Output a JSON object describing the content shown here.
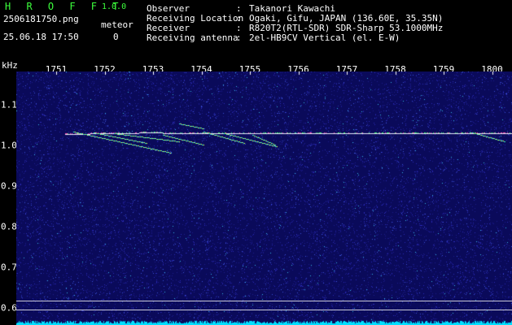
{
  "header": {
    "app_title": "H R O F F T",
    "version": "1.0.0",
    "filename": "2506181750.png",
    "timestamp": "25.06.18 17:50",
    "meteor_label": "meteor",
    "meteor_count": "0",
    "info": [
      {
        "label": "Observer",
        "sep": ":",
        "value": "Takanori Kawachi"
      },
      {
        "label": "Receiving Location",
        "sep": ":",
        "value": "Ogaki, Gifu, JAPAN (136.60E, 35.35N)"
      },
      {
        "label": "Receiver",
        "sep": ":",
        "value": "R820T2(RTL-SDR) SDR-Sharp 53.1000MHz"
      },
      {
        "label": "Receiving antenna",
        "sep": ":",
        "value": "2el-HB9CV Vertical (el. E-W)"
      }
    ]
  },
  "axes": {
    "y_unit": "kHz",
    "x_ticks": [
      "1751",
      "1752",
      "1753",
      "1754",
      "1755",
      "1756",
      "1757",
      "1758",
      "1759",
      "1800"
    ],
    "y_ticks": [
      "1.1",
      "1.0",
      "0.9",
      "0.8",
      "0.7",
      "0.6"
    ]
  },
  "colors": {
    "title_green": "#3cff3c",
    "background": "#0a0a5a",
    "trace": "#e8e8ff",
    "baseline": "#00e0ff"
  }
}
